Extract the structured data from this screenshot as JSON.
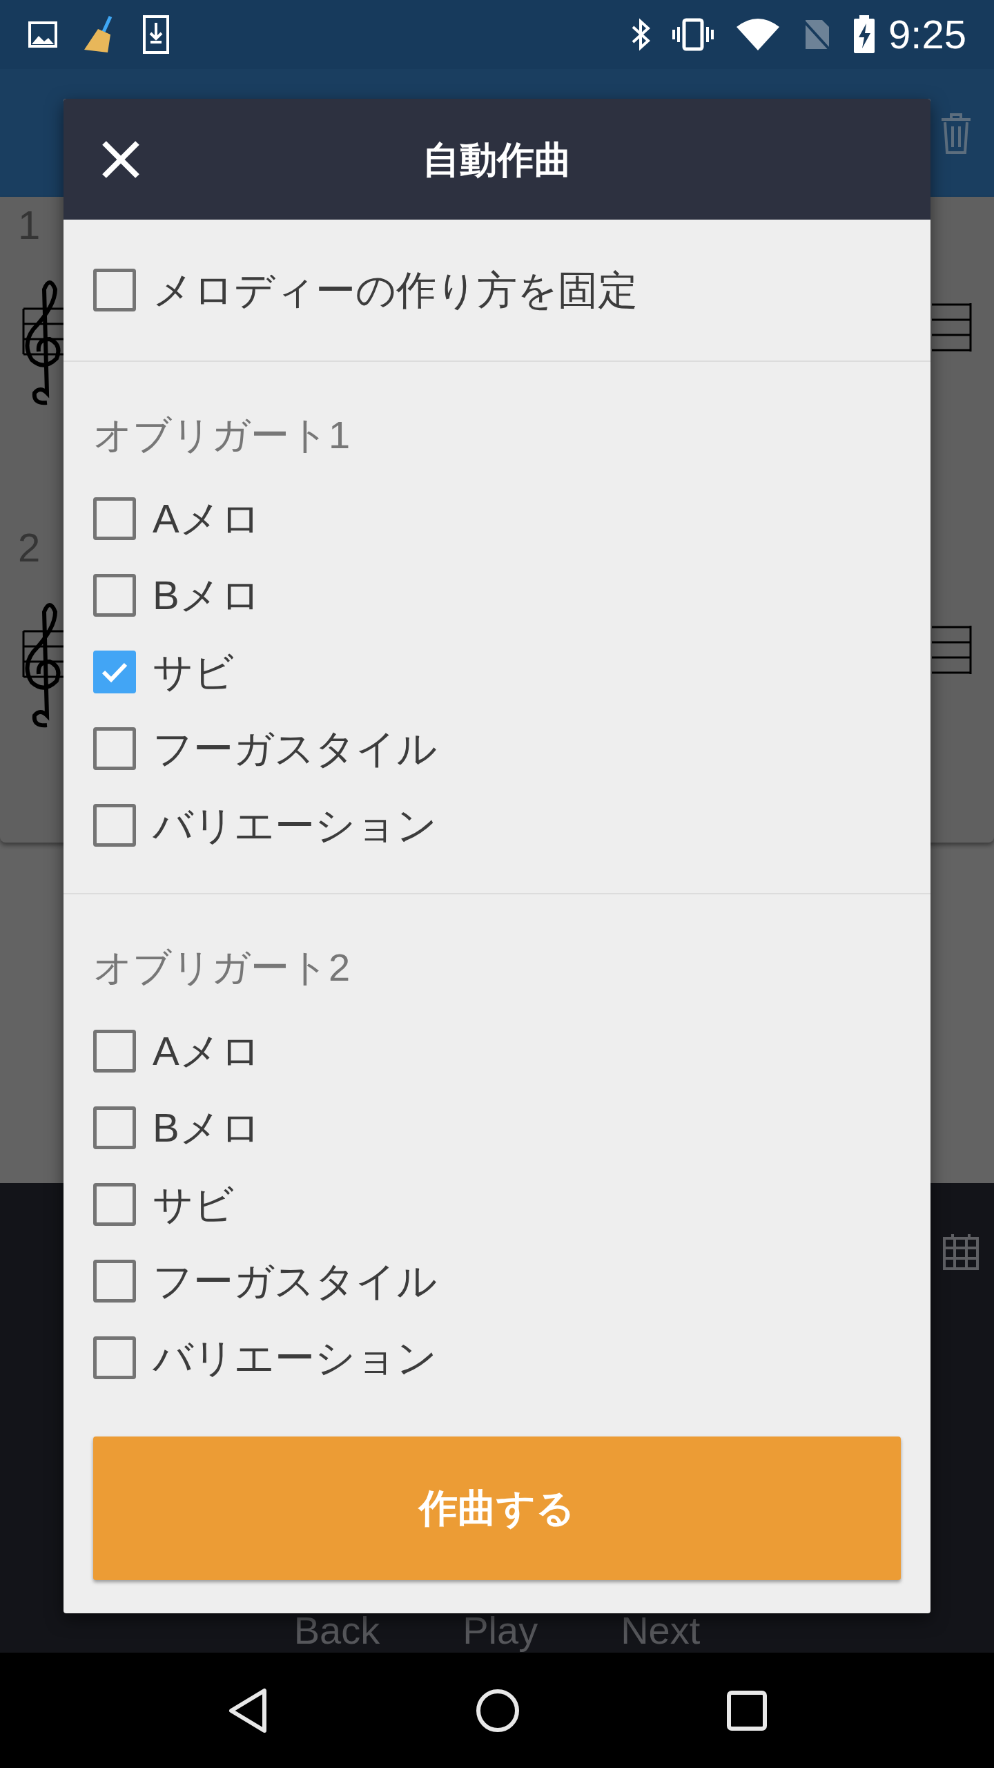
{
  "status_bar": {
    "time": "9:25"
  },
  "background": {
    "measures": [
      {
        "number": "1"
      },
      {
        "number": "2"
      }
    ],
    "transport": [
      "Back",
      "Play",
      "Next"
    ]
  },
  "dialog": {
    "title": "自動作曲",
    "options": [
      {
        "label": "メロディーの作り方を固定",
        "checked": false
      }
    ],
    "sections": [
      {
        "heading": "オブリガート1",
        "options": [
          {
            "label": "Aメロ",
            "checked": false
          },
          {
            "label": "Bメロ",
            "checked": false
          },
          {
            "label": "サビ",
            "checked": true
          },
          {
            "label": "フーガスタイル",
            "checked": false
          },
          {
            "label": "バリエーション",
            "checked": false
          }
        ]
      },
      {
        "heading": "オブリガート2",
        "options": [
          {
            "label": "Aメロ",
            "checked": false
          },
          {
            "label": "Bメロ",
            "checked": false
          },
          {
            "label": "サビ",
            "checked": false
          },
          {
            "label": "フーガスタイル",
            "checked": false
          },
          {
            "label": "バリエーション",
            "checked": false
          }
        ]
      }
    ],
    "button": "作曲する"
  }
}
